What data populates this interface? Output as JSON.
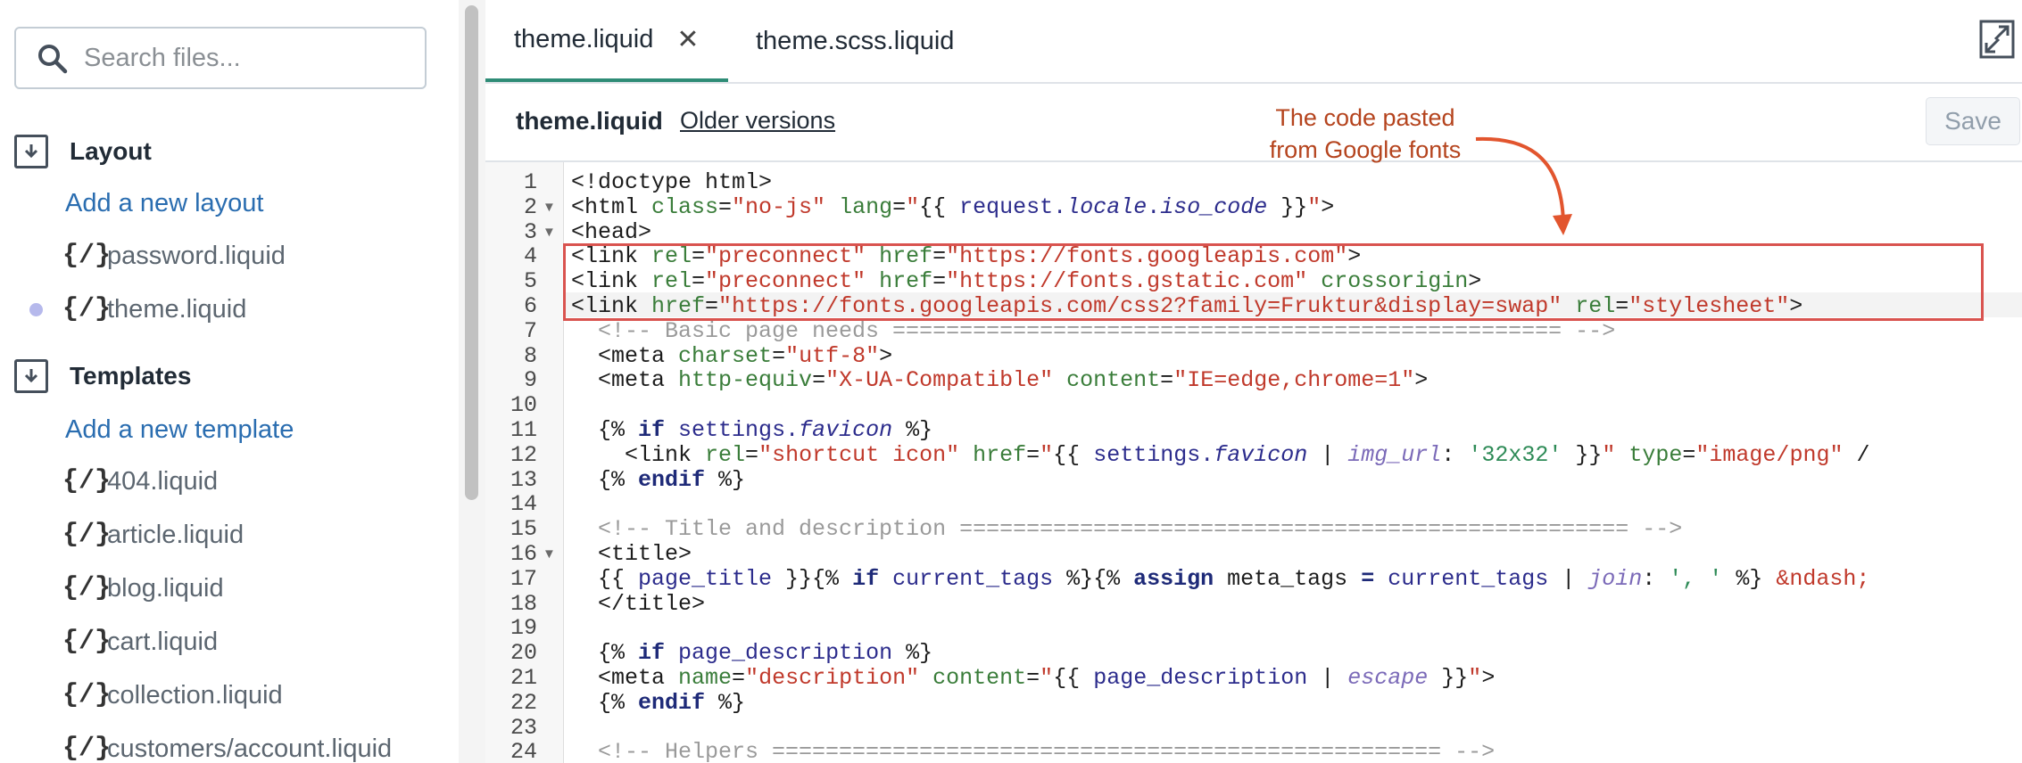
{
  "sidebar": {
    "search_placeholder": "Search files...",
    "sections": [
      {
        "title": "Layout",
        "add_label": "Add a new layout",
        "files": [
          "password.liquid",
          "theme.liquid"
        ]
      },
      {
        "title": "Templates",
        "add_label": "Add a new template",
        "files": [
          "404.liquid",
          "article.liquid",
          "blog.liquid",
          "cart.liquid",
          "collection.liquid",
          "customers/account.liquid"
        ]
      }
    ],
    "file_icon": "{/}"
  },
  "tabs": [
    {
      "label": "theme.liquid",
      "active": true,
      "close": "✕"
    },
    {
      "label": "theme.scss.liquid",
      "active": false
    }
  ],
  "header": {
    "filename": "theme.liquid",
    "older_versions": "Older versions",
    "save_label": "Save"
  },
  "annotation": {
    "text_line1": "The code pasted",
    "text_line2": "from Google fonts"
  },
  "editor": {
    "line_numbers": [
      "1",
      "2",
      "3",
      "4",
      "5",
      "6",
      "7",
      "8",
      "9",
      "10",
      "11",
      "12",
      "13",
      "14",
      "15",
      "16",
      "17",
      "18",
      "19",
      "20",
      "21",
      "22",
      "23",
      "24"
    ],
    "fold_markers": {
      "2": "▼",
      "3": "▼",
      "16": "▼"
    },
    "lines": [
      [
        [
          "t",
          "<!doctype html>"
        ]
      ],
      [
        [
          "t",
          "<html "
        ],
        [
          "a",
          "class"
        ],
        [
          "t",
          "="
        ],
        [
          "s",
          "\"no-js\""
        ],
        [
          "t",
          " "
        ],
        [
          "a",
          "lang"
        ],
        [
          "t",
          "="
        ],
        [
          "s",
          "\""
        ],
        [
          "t",
          "{{ "
        ],
        [
          "o",
          "request."
        ],
        [
          "p",
          "locale"
        ],
        [
          "o",
          "."
        ],
        [
          "p",
          "iso_code"
        ],
        [
          "t",
          " }}"
        ],
        [
          "s",
          "\""
        ],
        [
          "t",
          ">"
        ]
      ],
      [
        [
          "t",
          "<head>"
        ]
      ],
      [
        [
          "t",
          "<link "
        ],
        [
          "a",
          "rel"
        ],
        [
          "t",
          "="
        ],
        [
          "s",
          "\"preconnect\""
        ],
        [
          "t",
          " "
        ],
        [
          "a",
          "href"
        ],
        [
          "t",
          "="
        ],
        [
          "s",
          "\"https://fonts.googleapis.com\""
        ],
        [
          "t",
          ">"
        ]
      ],
      [
        [
          "t",
          "<link "
        ],
        [
          "a",
          "rel"
        ],
        [
          "t",
          "="
        ],
        [
          "s",
          "\"preconnect\""
        ],
        [
          "t",
          " "
        ],
        [
          "a",
          "href"
        ],
        [
          "t",
          "="
        ],
        [
          "s",
          "\"https://fonts.gstatic.com\""
        ],
        [
          "t",
          " "
        ],
        [
          "a",
          "crossorigin"
        ],
        [
          "t",
          ">"
        ]
      ],
      [
        [
          "t",
          "<link "
        ],
        [
          "a",
          "href"
        ],
        [
          "t",
          "="
        ],
        [
          "s",
          "\"https://fonts.googleapis.com/css2?family=Fruktur&display=swap\""
        ],
        [
          "t",
          " "
        ],
        [
          "a",
          "rel"
        ],
        [
          "t",
          "="
        ],
        [
          "s",
          "\"stylesheet\""
        ],
        [
          "t",
          ">"
        ]
      ],
      [
        [
          "c",
          "  <!-- Basic page needs ================================================== -->"
        ]
      ],
      [
        [
          "t",
          "  <meta "
        ],
        [
          "a",
          "charset"
        ],
        [
          "t",
          "="
        ],
        [
          "s",
          "\"utf-8\""
        ],
        [
          "t",
          ">"
        ]
      ],
      [
        [
          "t",
          "  <meta "
        ],
        [
          "a",
          "http-equiv"
        ],
        [
          "t",
          "="
        ],
        [
          "s",
          "\"X-UA-Compatible\""
        ],
        [
          "t",
          " "
        ],
        [
          "a",
          "content"
        ],
        [
          "t",
          "="
        ],
        [
          "s",
          "\"IE=edge,chrome=1\""
        ],
        [
          "t",
          ">"
        ]
      ],
      [
        [
          "t",
          ""
        ]
      ],
      [
        [
          "t",
          "  {% "
        ],
        [
          "k",
          "if"
        ],
        [
          "t",
          " "
        ],
        [
          "o",
          "settings."
        ],
        [
          "p",
          "favicon"
        ],
        [
          "t",
          " %}"
        ]
      ],
      [
        [
          "t",
          "    <link "
        ],
        [
          "a",
          "rel"
        ],
        [
          "t",
          "="
        ],
        [
          "s",
          "\"shortcut icon\""
        ],
        [
          "t",
          " "
        ],
        [
          "a",
          "href"
        ],
        [
          "t",
          "="
        ],
        [
          "s",
          "\""
        ],
        [
          "t",
          "{{ "
        ],
        [
          "o",
          "settings."
        ],
        [
          "p",
          "favicon"
        ],
        [
          "t",
          " | "
        ],
        [
          "f",
          "img_url"
        ],
        [
          "t",
          ": "
        ],
        [
          "n",
          "'32x32'"
        ],
        [
          "t",
          " }}"
        ],
        [
          "s",
          "\""
        ],
        [
          "t",
          " "
        ],
        [
          "a",
          "type"
        ],
        [
          "t",
          "="
        ],
        [
          "s",
          "\"image/png\""
        ],
        [
          "t",
          " /"
        ]
      ],
      [
        [
          "t",
          "  {% "
        ],
        [
          "k",
          "endif"
        ],
        [
          "t",
          " %}"
        ]
      ],
      [
        [
          "t",
          ""
        ]
      ],
      [
        [
          "c",
          "  <!-- Title and description ================================================== -->"
        ]
      ],
      [
        [
          "t",
          "  <title>"
        ]
      ],
      [
        [
          "t",
          "  {{ "
        ],
        [
          "o",
          "page_title"
        ],
        [
          "t",
          " }}{% "
        ],
        [
          "k",
          "if"
        ],
        [
          "t",
          " "
        ],
        [
          "o",
          "current_tags"
        ],
        [
          "t",
          " %}{% "
        ],
        [
          "k",
          "assign"
        ],
        [
          "t",
          " meta_tags "
        ],
        [
          "k",
          "="
        ],
        [
          "t",
          " "
        ],
        [
          "o",
          "current_tags"
        ],
        [
          "t",
          " | "
        ],
        [
          "f",
          "join"
        ],
        [
          "t",
          ": "
        ],
        [
          "n",
          "', '"
        ],
        [
          "t",
          " %} "
        ],
        [
          "s",
          "&ndash;"
        ]
      ],
      [
        [
          "t",
          "  </title>"
        ]
      ],
      [
        [
          "t",
          ""
        ]
      ],
      [
        [
          "t",
          "  {% "
        ],
        [
          "k",
          "if"
        ],
        [
          "t",
          " "
        ],
        [
          "o",
          "page_description"
        ],
        [
          "t",
          " %}"
        ]
      ],
      [
        [
          "t",
          "  <meta "
        ],
        [
          "a",
          "name"
        ],
        [
          "t",
          "="
        ],
        [
          "s",
          "\"description\""
        ],
        [
          "t",
          " "
        ],
        [
          "a",
          "content"
        ],
        [
          "t",
          "="
        ],
        [
          "s",
          "\""
        ],
        [
          "t",
          "{{ "
        ],
        [
          "o",
          "page_description"
        ],
        [
          "t",
          " | "
        ],
        [
          "f",
          "escape"
        ],
        [
          "t",
          " }}"
        ],
        [
          "s",
          "\""
        ],
        [
          "t",
          ">"
        ]
      ],
      [
        [
          "t",
          "  {% "
        ],
        [
          "k",
          "endif"
        ],
        [
          "t",
          " %}"
        ]
      ],
      [
        [
          "t",
          ""
        ]
      ],
      [
        [
          "c",
          "  <!-- Helpers ================================================== -->"
        ]
      ]
    ]
  }
}
